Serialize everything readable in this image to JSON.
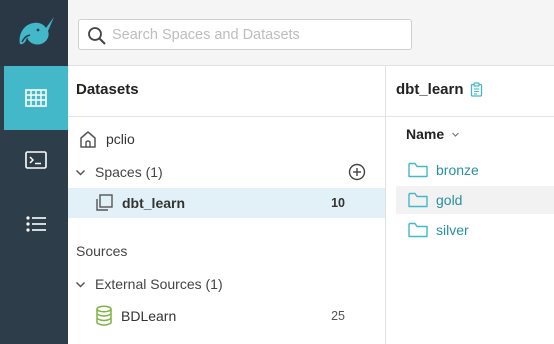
{
  "colors": {
    "rail_bg": "#2d3d4a",
    "accent": "#43b8c9",
    "link": "#2b8fa3",
    "selected_row": "#e2f0f7"
  },
  "nav": {
    "logo": "narwhal-logo-icon",
    "items": [
      {
        "icon": "datasets-grid-icon",
        "active": true
      },
      {
        "icon": "sql-terminal-icon",
        "active": false
      },
      {
        "icon": "jobs-list-icon",
        "active": false
      }
    ]
  },
  "search": {
    "placeholder": "Search Spaces and Datasets",
    "value": ""
  },
  "datasets_panel": {
    "title": "Datasets",
    "home": {
      "label": "pclio",
      "icon": "home-icon"
    },
    "spaces": {
      "label": "Spaces (1)",
      "expanded": true,
      "add_icon": "add-circle-icon",
      "items": [
        {
          "label": "dbt_learn",
          "count": "10",
          "icon": "space-icon",
          "selected": true
        }
      ]
    },
    "sources_heading": "Sources",
    "external_sources": {
      "label": "External Sources (1)",
      "expanded": true,
      "items": [
        {
          "label": "BDLearn",
          "count": "25",
          "icon": "database-icon"
        }
      ]
    }
  },
  "content": {
    "title": "dbt_learn",
    "copy_icon": "clipboard-icon",
    "column_header": "Name",
    "sort_icon": "chevron-down-icon",
    "folders": [
      {
        "name": "bronze"
      },
      {
        "name": "gold"
      },
      {
        "name": "silver"
      }
    ]
  }
}
